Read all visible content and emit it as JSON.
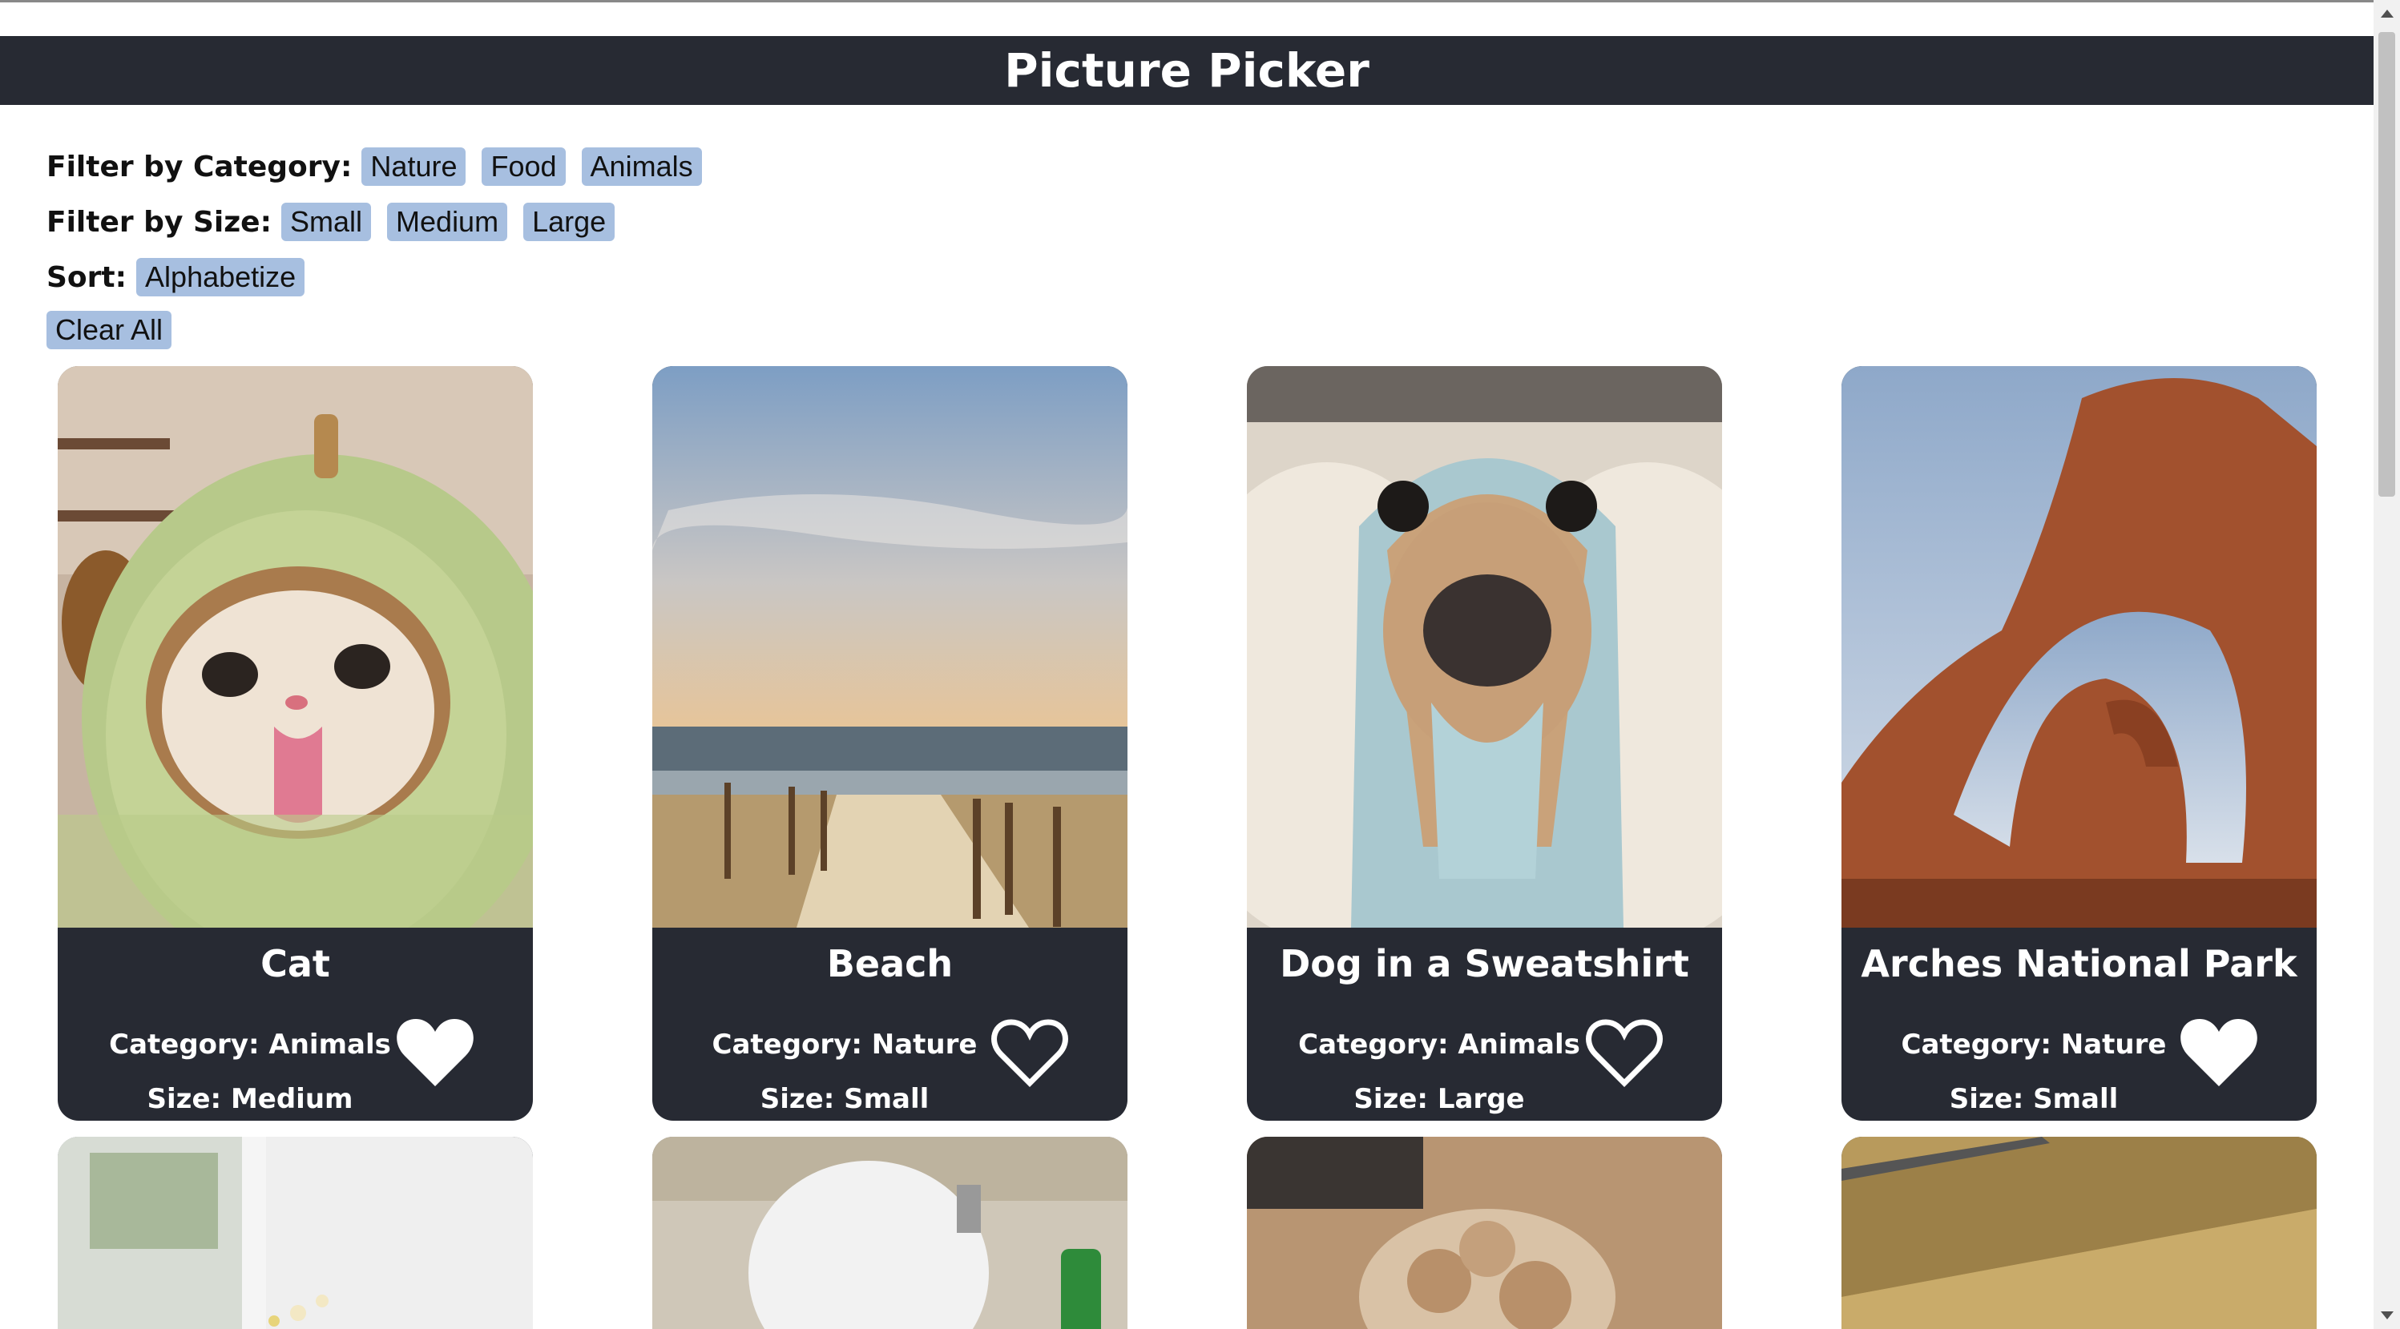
{
  "header": {
    "title": "Picture Picker"
  },
  "filters": {
    "category_label": "Filter by Category:",
    "categories": [
      "Nature",
      "Food",
      "Animals"
    ],
    "size_label": "Filter by Size:",
    "sizes": [
      "Small",
      "Medium",
      "Large"
    ],
    "sort_label": "Sort:",
    "sort_options": [
      "Alphabetize"
    ],
    "clear_label": "Clear All"
  },
  "cards": [
    {
      "title": "Cat",
      "category": "Category: Animals",
      "size": "Size: Medium",
      "favorited": true,
      "image": "cat-in-avocado-costume"
    },
    {
      "title": "Beach",
      "category": "Category: Nature",
      "size": "Size: Small",
      "favorited": false,
      "image": "beach-boardwalk-sunset"
    },
    {
      "title": "Dog in a Sweatshirt",
      "category": "Category: Animals",
      "size": "Size: Large",
      "favorited": false,
      "image": "dog-in-hoodie"
    },
    {
      "title": "Arches National Park",
      "category": "Category: Nature",
      "size": "Size: Small",
      "favorited": true,
      "image": "red-rock-arches"
    }
  ],
  "lower_cards": [
    {
      "image": "window-with-flowers"
    },
    {
      "image": "cat-bath-foam"
    },
    {
      "image": "cinnamon-rolls"
    },
    {
      "image": "window-blinds"
    }
  ],
  "colors": {
    "header_bg": "#272a33",
    "chip_bg": "#a7bfe0",
    "card_bg": "#272a33"
  }
}
